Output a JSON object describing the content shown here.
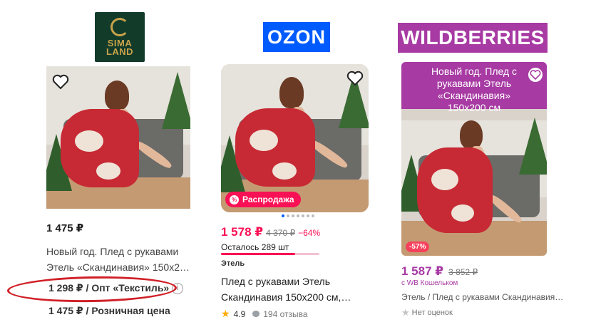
{
  "logos": {
    "sima_line1": "SIMA",
    "sima_line2": "LAND",
    "ozon": "OZON",
    "wildberries": "WILDBERRIES"
  },
  "sima": {
    "price": "1 475 ₽",
    "title_line1": "Новый год. Плед с рукавами",
    "title_line2": "Этель «Скандинавия» 150x2…",
    "wholesale": "1 298 ₽ / Опт «Текстиль»",
    "retail": "1 475 ₽ / Розничная цена",
    "info_icon": "i"
  },
  "ozon": {
    "sale_badge": "Распродажа",
    "sale_badge_icon": "%",
    "price": "1 578 ₽",
    "old_price": "4 370 ₽",
    "discount": "−64%",
    "stock": "Осталось 289 шт",
    "stock_remaining_fraction": 0.75,
    "brand": "Этель",
    "title_line1": "Плед с рукавами Этель",
    "title_line2": "Скандинавия 150x200 см,…",
    "rating": "4.9",
    "reviews": "194 отзыва",
    "accent": "#f91155"
  },
  "wb": {
    "banner": "Новый год. Плед с рукавами Этель «Скандинавия» 150x200 см",
    "discount": "-57%",
    "price": "1 587 ₽",
    "old_price": "3 852 ₽",
    "wallet_note": "с WB Кошельком",
    "title": "Этель / Плед с рукавами Скандинавия…",
    "rating": "Нет оценок",
    "accent": "#a73aa3"
  }
}
